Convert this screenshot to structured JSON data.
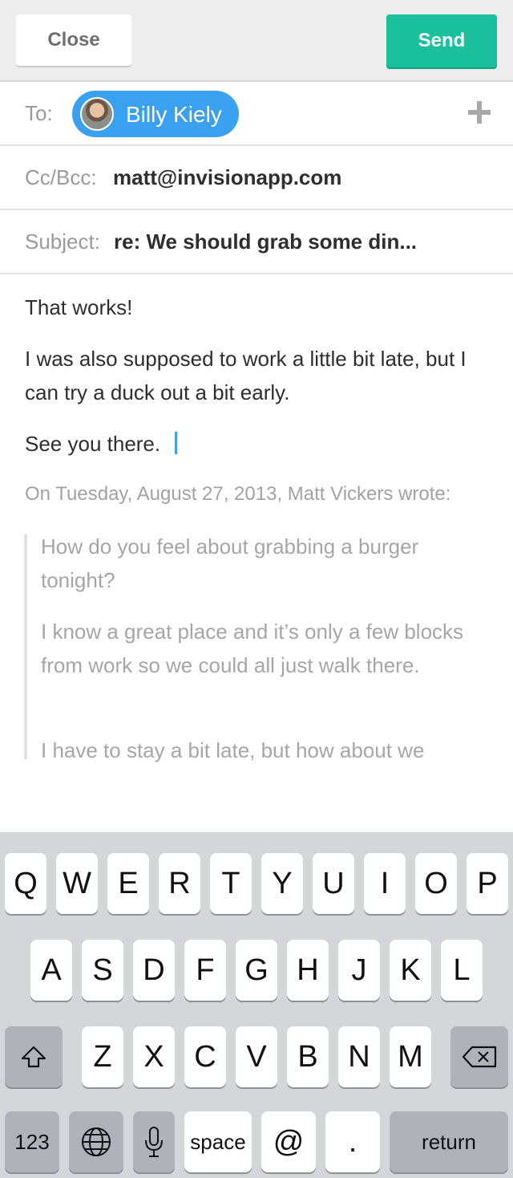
{
  "toolbar": {
    "close_label": "Close",
    "send_label": "Send"
  },
  "to": {
    "label": "To:",
    "recipient": "Billy Kiely"
  },
  "cc": {
    "label": "Cc/Bcc:",
    "value": "matt@invisionapp.com"
  },
  "subject": {
    "label": "Subject:",
    "value": "re: We should grab some din..."
  },
  "message": {
    "lines": [
      "That works!",
      "I was also supposed to work a little bit late, but I can try a duck out a bit early.",
      "See you there."
    ]
  },
  "quote": {
    "header": "On Tuesday, August 27, 2013, Matt Vickers wrote:",
    "paragraphs": [
      "How do you feel about grabbing a burger tonight?",
      "I know a great place and it’s only a few blocks from work so we could all just walk there.",
      "I have to stay a bit late, but how about we"
    ]
  },
  "keyboard": {
    "row1": [
      "Q",
      "W",
      "E",
      "R",
      "T",
      "Y",
      "U",
      "I",
      "O",
      "P"
    ],
    "row2": [
      "A",
      "S",
      "D",
      "F",
      "G",
      "H",
      "J",
      "K",
      "L"
    ],
    "row3": [
      "Z",
      "X",
      "C",
      "V",
      "B",
      "N",
      "M"
    ],
    "numbers_label": "123",
    "space_label": "space",
    "at_label": "@",
    "dot_label": ".",
    "return_label": "return"
  }
}
